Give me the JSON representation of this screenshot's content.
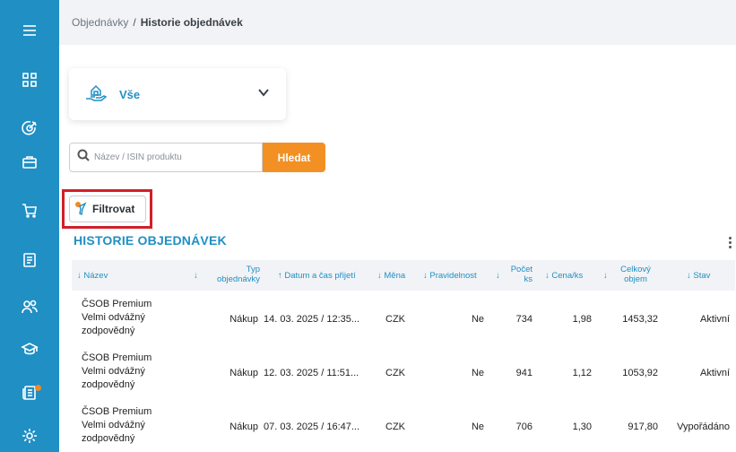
{
  "sidebar": {
    "icons": [
      "menu-icon",
      "dashboard-icon",
      "target-icon",
      "briefcase-icon",
      "cart-icon",
      "document-icon",
      "users-icon",
      "graduation-cap-icon",
      "news-icon",
      "settings-icon"
    ]
  },
  "breadcrumb": {
    "parent": "Objednávky",
    "separator": "/",
    "current": "Historie objednávek"
  },
  "selector": {
    "value": "Vše"
  },
  "search": {
    "placeholder": "Název / ISIN produktu",
    "button_label": "Hledat"
  },
  "filter": {
    "label": "Filtrovat"
  },
  "section_title": "HISTORIE OBJEDNÁVEK",
  "table": {
    "headers": {
      "name": "↓ Název",
      "type_arrow": "↓",
      "type_line1": "Typ",
      "type_line2": "objednávky",
      "date": "↑ Datum a čas přijetí",
      "currency": "↓ Měna",
      "regular": "↓ Pravidelnost",
      "count_arrow": "↓",
      "count_line1": "Počet",
      "count_line2": "ks",
      "price": "↓ Cena/ks",
      "volume_arrow": "↓",
      "volume_line1": "Celkový",
      "volume_line2": "objem",
      "status": "↓ Stav"
    },
    "rows": [
      {
        "name1": "ČSOB Premium",
        "name2": "Velmi odvážný",
        "name3": "zodpovědný",
        "type": "Nákup",
        "date": "14. 03. 2025 / 12:35...",
        "currency": "CZK",
        "regular": "Ne",
        "count": "734",
        "price": "1,98",
        "volume": "1453,32",
        "status": "Aktivní"
      },
      {
        "name1": "ČSOB Premium",
        "name2": "Velmi odvážný",
        "name3": "zodpovědný",
        "type": "Nákup",
        "date": "12. 03. 2025 / 11:51...",
        "currency": "CZK",
        "regular": "Ne",
        "count": "941",
        "price": "1,12",
        "volume": "1053,92",
        "status": "Aktivní"
      },
      {
        "name1": "ČSOB Premium",
        "name2": "Velmi odvážný",
        "name3": "zodpovědný",
        "type": "Nákup",
        "date": "07. 03. 2025 / 16:47...",
        "currency": "CZK",
        "regular": "Ne",
        "count": "706",
        "price": "1,30",
        "volume": "917,80",
        "status": "Vypořádáno"
      }
    ]
  },
  "colors": {
    "sidebar": "#1f8fc4",
    "accent": "#1f8fc4",
    "button": "#f39023",
    "highlight": "#d0202a"
  }
}
